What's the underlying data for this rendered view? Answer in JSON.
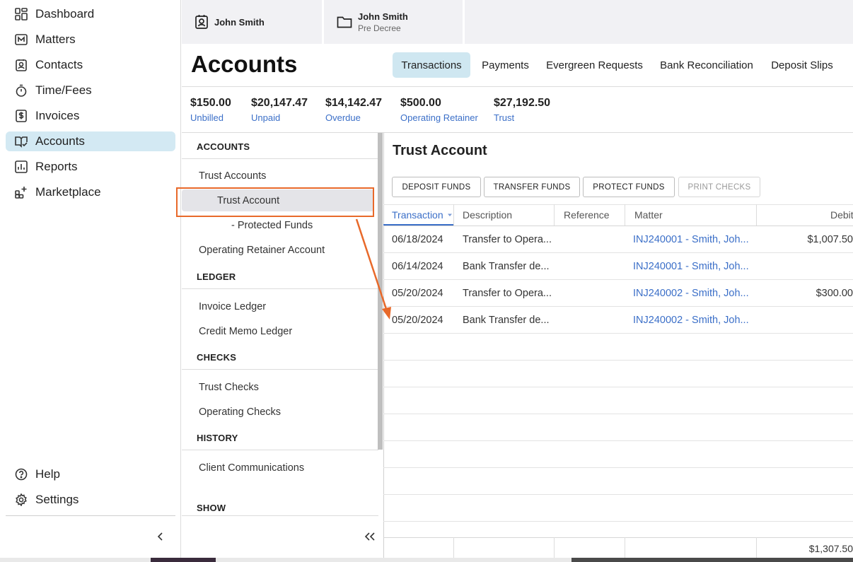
{
  "sidebar": {
    "items": [
      {
        "label": "Dashboard",
        "icon": "dashboard-grid-icon"
      },
      {
        "label": "Matters",
        "icon": "matters-m-icon"
      },
      {
        "label": "Contacts",
        "icon": "contact-card-icon"
      },
      {
        "label": "Time/Fees",
        "icon": "stopwatch-icon"
      },
      {
        "label": "Invoices",
        "icon": "dollar-document-icon"
      },
      {
        "label": "Accounts",
        "icon": "book-check-icon",
        "active": true
      },
      {
        "label": "Reports",
        "icon": "bar-chart-icon"
      },
      {
        "label": "Marketplace",
        "icon": "apps-plus-icon"
      }
    ],
    "help_label": "Help",
    "settings_label": "Settings"
  },
  "top_tabs": [
    {
      "name": "John Smith",
      "subtitle": "",
      "icon": "contact-card-icon"
    },
    {
      "name": "John Smith",
      "subtitle": "Pre Decree",
      "icon": "folder-icon"
    }
  ],
  "header": {
    "title": "Accounts",
    "tabs": [
      "Transactions",
      "Payments",
      "Evergreen Requests",
      "Bank Reconciliation",
      "Deposit Slips"
    ],
    "active_tab": "Transactions"
  },
  "stats": [
    {
      "value": "$150.00",
      "label": "Unbilled"
    },
    {
      "value": "$20,147.47",
      "label": "Unpaid"
    },
    {
      "value": "$14,142.47",
      "label": "Overdue"
    },
    {
      "value": "$500.00",
      "label": "Operating Retainer"
    },
    {
      "value": "$27,192.50",
      "label": "Trust"
    }
  ],
  "tree": {
    "accounts_heading": "ACCOUNTS",
    "trust_accounts": "Trust Accounts",
    "trust_account": "Trust Account",
    "protected_funds": "- Protected Funds",
    "operating_retainer": "Operating Retainer Account",
    "ledger_heading": "LEDGER",
    "invoice_ledger": "Invoice Ledger",
    "credit_memo_ledger": "Credit Memo Ledger",
    "checks_heading": "CHECKS",
    "trust_checks": "Trust Checks",
    "operating_checks": "Operating Checks",
    "history_heading": "HISTORY",
    "client_communications": "Client Communications",
    "show_heading": "SHOW"
  },
  "panel": {
    "title": "Trust Account",
    "buttons": [
      "DEPOSIT FUNDS",
      "TRANSFER FUNDS",
      "PROTECT FUNDS",
      "PRINT CHECKS"
    ]
  },
  "table": {
    "columns": [
      "Transaction",
      "Description",
      "Reference",
      "Matter",
      "Debit"
    ],
    "rows": [
      {
        "date": "06/18/2024",
        "description": "Transfer to Opera...",
        "reference": "",
        "matter": "INJ240001 - Smith, Joh...",
        "debit": "$1,007.50"
      },
      {
        "date": "06/14/2024",
        "description": "Bank Transfer de...",
        "reference": "",
        "matter": "INJ240001 - Smith, Joh...",
        "debit": ""
      },
      {
        "date": "05/20/2024",
        "description": "Transfer to Opera...",
        "reference": "",
        "matter": "INJ240002 - Smith, Joh...",
        "debit": "$300.00"
      },
      {
        "date": "05/20/2024",
        "description": "Bank Transfer de...",
        "reference": "",
        "matter": "INJ240002 - Smith, Joh...",
        "debit": ""
      }
    ],
    "total_debit": "$1,307.50"
  },
  "colors": {
    "accent_blue": "#3b6fc8",
    "active_nav_bg": "#d3e9f3",
    "annotation_orange": "#e8692a"
  }
}
